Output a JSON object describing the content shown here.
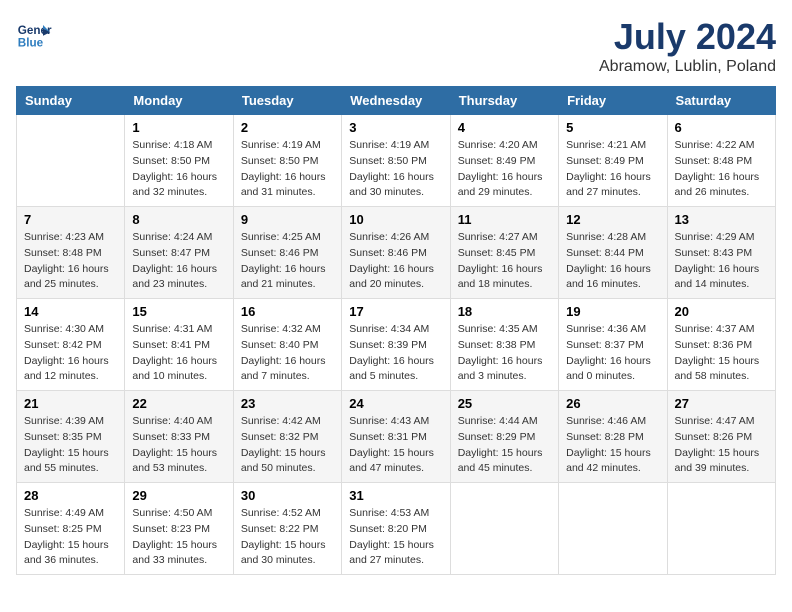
{
  "logo": {
    "line1": "General",
    "line2": "Blue"
  },
  "title": "July 2024",
  "subtitle": "Abramow, Lublin, Poland",
  "days": [
    "Sunday",
    "Monday",
    "Tuesday",
    "Wednesday",
    "Thursday",
    "Friday",
    "Saturday"
  ],
  "weeks": [
    [
      {
        "date": "",
        "info": ""
      },
      {
        "date": "1",
        "info": "Sunrise: 4:18 AM\nSunset: 8:50 PM\nDaylight: 16 hours\nand 32 minutes."
      },
      {
        "date": "2",
        "info": "Sunrise: 4:19 AM\nSunset: 8:50 PM\nDaylight: 16 hours\nand 31 minutes."
      },
      {
        "date": "3",
        "info": "Sunrise: 4:19 AM\nSunset: 8:50 PM\nDaylight: 16 hours\nand 30 minutes."
      },
      {
        "date": "4",
        "info": "Sunrise: 4:20 AM\nSunset: 8:49 PM\nDaylight: 16 hours\nand 29 minutes."
      },
      {
        "date": "5",
        "info": "Sunrise: 4:21 AM\nSunset: 8:49 PM\nDaylight: 16 hours\nand 27 minutes."
      },
      {
        "date": "6",
        "info": "Sunrise: 4:22 AM\nSunset: 8:48 PM\nDaylight: 16 hours\nand 26 minutes."
      }
    ],
    [
      {
        "date": "7",
        "info": "Sunrise: 4:23 AM\nSunset: 8:48 PM\nDaylight: 16 hours\nand 25 minutes."
      },
      {
        "date": "8",
        "info": "Sunrise: 4:24 AM\nSunset: 8:47 PM\nDaylight: 16 hours\nand 23 minutes."
      },
      {
        "date": "9",
        "info": "Sunrise: 4:25 AM\nSunset: 8:46 PM\nDaylight: 16 hours\nand 21 minutes."
      },
      {
        "date": "10",
        "info": "Sunrise: 4:26 AM\nSunset: 8:46 PM\nDaylight: 16 hours\nand 20 minutes."
      },
      {
        "date": "11",
        "info": "Sunrise: 4:27 AM\nSunset: 8:45 PM\nDaylight: 16 hours\nand 18 minutes."
      },
      {
        "date": "12",
        "info": "Sunrise: 4:28 AM\nSunset: 8:44 PM\nDaylight: 16 hours\nand 16 minutes."
      },
      {
        "date": "13",
        "info": "Sunrise: 4:29 AM\nSunset: 8:43 PM\nDaylight: 16 hours\nand 14 minutes."
      }
    ],
    [
      {
        "date": "14",
        "info": "Sunrise: 4:30 AM\nSunset: 8:42 PM\nDaylight: 16 hours\nand 12 minutes."
      },
      {
        "date": "15",
        "info": "Sunrise: 4:31 AM\nSunset: 8:41 PM\nDaylight: 16 hours\nand 10 minutes."
      },
      {
        "date": "16",
        "info": "Sunrise: 4:32 AM\nSunset: 8:40 PM\nDaylight: 16 hours\nand 7 minutes."
      },
      {
        "date": "17",
        "info": "Sunrise: 4:34 AM\nSunset: 8:39 PM\nDaylight: 16 hours\nand 5 minutes."
      },
      {
        "date": "18",
        "info": "Sunrise: 4:35 AM\nSunset: 8:38 PM\nDaylight: 16 hours\nand 3 minutes."
      },
      {
        "date": "19",
        "info": "Sunrise: 4:36 AM\nSunset: 8:37 PM\nDaylight: 16 hours\nand 0 minutes."
      },
      {
        "date": "20",
        "info": "Sunrise: 4:37 AM\nSunset: 8:36 PM\nDaylight: 15 hours\nand 58 minutes."
      }
    ],
    [
      {
        "date": "21",
        "info": "Sunrise: 4:39 AM\nSunset: 8:35 PM\nDaylight: 15 hours\nand 55 minutes."
      },
      {
        "date": "22",
        "info": "Sunrise: 4:40 AM\nSunset: 8:33 PM\nDaylight: 15 hours\nand 53 minutes."
      },
      {
        "date": "23",
        "info": "Sunrise: 4:42 AM\nSunset: 8:32 PM\nDaylight: 15 hours\nand 50 minutes."
      },
      {
        "date": "24",
        "info": "Sunrise: 4:43 AM\nSunset: 8:31 PM\nDaylight: 15 hours\nand 47 minutes."
      },
      {
        "date": "25",
        "info": "Sunrise: 4:44 AM\nSunset: 8:29 PM\nDaylight: 15 hours\nand 45 minutes."
      },
      {
        "date": "26",
        "info": "Sunrise: 4:46 AM\nSunset: 8:28 PM\nDaylight: 15 hours\nand 42 minutes."
      },
      {
        "date": "27",
        "info": "Sunrise: 4:47 AM\nSunset: 8:26 PM\nDaylight: 15 hours\nand 39 minutes."
      }
    ],
    [
      {
        "date": "28",
        "info": "Sunrise: 4:49 AM\nSunset: 8:25 PM\nDaylight: 15 hours\nand 36 minutes."
      },
      {
        "date": "29",
        "info": "Sunrise: 4:50 AM\nSunset: 8:23 PM\nDaylight: 15 hours\nand 33 minutes."
      },
      {
        "date": "30",
        "info": "Sunrise: 4:52 AM\nSunset: 8:22 PM\nDaylight: 15 hours\nand 30 minutes."
      },
      {
        "date": "31",
        "info": "Sunrise: 4:53 AM\nSunset: 8:20 PM\nDaylight: 15 hours\nand 27 minutes."
      },
      {
        "date": "",
        "info": ""
      },
      {
        "date": "",
        "info": ""
      },
      {
        "date": "",
        "info": ""
      }
    ]
  ]
}
